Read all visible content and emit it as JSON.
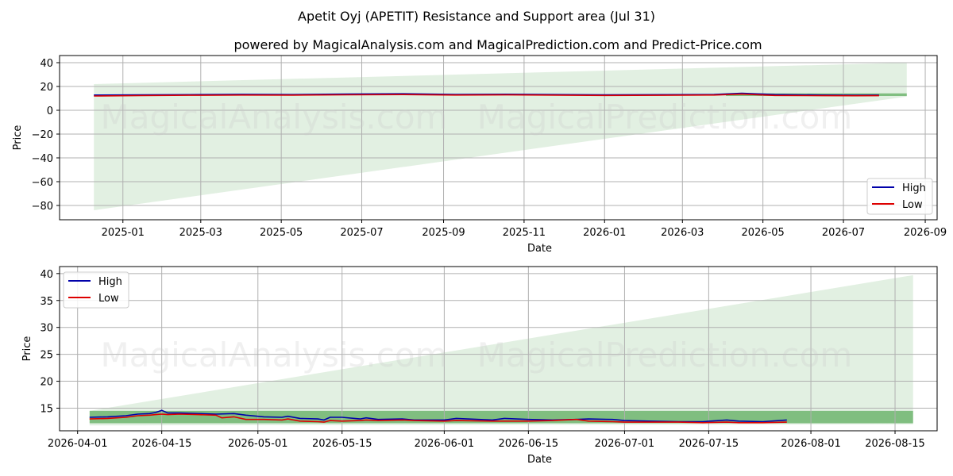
{
  "title": "Apetit Oyj (APETIT) Resistance and Support area (Jul 31)",
  "subtitle": "powered by MagicalAnalysis.com and MagicalPrediction.com and Predict-Price.com",
  "watermarks": [
    "MagicalAnalysis.com",
    "MagicalPrediction.com"
  ],
  "colors": {
    "high": "#0000aa",
    "low": "#dd0000",
    "band_light": "#d6ead6",
    "band_dark": "#5fae5f",
    "grid": "#b0b0b0"
  },
  "chart_data": [
    {
      "type": "line",
      "xlabel": "Date",
      "ylabel": "Price",
      "ylim": [
        -92,
        46
      ],
      "yticks": [
        40,
        20,
        0,
        -20,
        -40,
        -60,
        -80
      ],
      "xticks": [
        "2025-01",
        "2025-03",
        "2025-05",
        "2025-07",
        "2025-09",
        "2025-11",
        "2026-01",
        "2026-03",
        "2026-05",
        "2026-07",
        "2026-09"
      ],
      "xlim": [
        "2024-11-14",
        "2026-09-10"
      ],
      "grid": true,
      "legend": "lower-right",
      "series": [
        {
          "name": "High",
          "x": [
            "2024-12-10",
            "2025-01-15",
            "2025-02-20",
            "2025-04-01",
            "2025-05-10",
            "2025-06-20",
            "2025-08-01",
            "2025-09-10",
            "2025-10-20",
            "2025-11-25",
            "2026-01-01",
            "2026-02-15",
            "2026-03-25",
            "2026-04-15",
            "2026-05-10",
            "2026-06-15",
            "2026-07-10",
            "2026-07-28"
          ],
          "values": [
            12.8,
            13.0,
            13.1,
            13.4,
            13.2,
            13.6,
            13.9,
            13.3,
            13.5,
            13.2,
            13.0,
            13.1,
            13.3,
            14.3,
            13.2,
            12.8,
            12.6,
            12.7
          ]
        },
        {
          "name": "Low",
          "x": [
            "2024-12-10",
            "2025-01-15",
            "2025-02-20",
            "2025-04-01",
            "2025-05-10",
            "2025-06-20",
            "2025-08-01",
            "2025-09-10",
            "2025-10-20",
            "2025-11-25",
            "2026-01-01",
            "2026-02-15",
            "2026-03-25",
            "2026-04-15",
            "2026-05-10",
            "2026-06-15",
            "2026-07-10",
            "2026-07-28"
          ],
          "values": [
            12.0,
            12.4,
            12.6,
            12.8,
            12.7,
            13.0,
            13.2,
            12.8,
            12.9,
            12.7,
            12.5,
            12.6,
            12.8,
            13.6,
            12.5,
            12.3,
            12.2,
            12.3
          ]
        }
      ],
      "support_area": {
        "x": [
          "2024-12-10",
          "2026-08-18"
        ],
        "upper": [
          22,
          40
        ],
        "lower": [
          -84,
          11.5
        ]
      },
      "resistance_band": {
        "x": [
          "2026-04-03",
          "2026-08-18"
        ],
        "upper": 14.2,
        "lower": 12.0
      }
    },
    {
      "type": "line",
      "xlabel": "Date",
      "ylabel": "Price",
      "ylim": [
        10.8,
        41.3
      ],
      "yticks": [
        15,
        20,
        25,
        30,
        35,
        40
      ],
      "xticks": [
        "2026-04-01",
        "2026-04-15",
        "2026-05-01",
        "2026-05-15",
        "2026-06-01",
        "2026-06-15",
        "2026-07-01",
        "2026-07-15",
        "2026-08-01",
        "2026-08-15"
      ],
      "xlim": [
        "2026-03-29",
        "2026-08-22"
      ],
      "grid": true,
      "legend": "upper-left",
      "series": [
        {
          "name": "High",
          "x": [
            "2026-04-03",
            "2026-04-06",
            "2026-04-09",
            "2026-04-11",
            "2026-04-13",
            "2026-04-14",
            "2026-04-15",
            "2026-04-16",
            "2026-04-18",
            "2026-04-21",
            "2026-04-24",
            "2026-04-27",
            "2026-04-29",
            "2026-05-02",
            "2026-05-05",
            "2026-05-06",
            "2026-05-08",
            "2026-05-11",
            "2026-05-12",
            "2026-05-13",
            "2026-05-15",
            "2026-05-18",
            "2026-05-19",
            "2026-05-21",
            "2026-05-25",
            "2026-05-27",
            "2026-06-01",
            "2026-06-03",
            "2026-06-09",
            "2026-06-11",
            "2026-06-15",
            "2026-06-19",
            "2026-06-23",
            "2026-06-25",
            "2026-06-29",
            "2026-07-01",
            "2026-07-05",
            "2026-07-10",
            "2026-07-14",
            "2026-07-18",
            "2026-07-20",
            "2026-07-24",
            "2026-07-28"
          ],
          "values": [
            13.3,
            13.4,
            13.6,
            13.9,
            14.0,
            14.2,
            14.6,
            14.1,
            14.1,
            14.0,
            13.9,
            14.0,
            13.7,
            13.4,
            13.3,
            13.5,
            13.1,
            13.0,
            12.8,
            13.3,
            13.3,
            13.0,
            13.2,
            12.9,
            13.0,
            12.8,
            12.8,
            13.1,
            12.8,
            13.1,
            12.9,
            12.8,
            12.9,
            13.0,
            12.9,
            12.7,
            12.6,
            12.5,
            12.5,
            12.8,
            12.6,
            12.5,
            12.8
          ]
        },
        {
          "name": "Low",
          "x": [
            "2026-04-03",
            "2026-04-06",
            "2026-04-09",
            "2026-04-11",
            "2026-04-13",
            "2026-04-14",
            "2026-04-15",
            "2026-04-16",
            "2026-04-18",
            "2026-04-21",
            "2026-04-24",
            "2026-04-25",
            "2026-04-27",
            "2026-04-29",
            "2026-05-02",
            "2026-05-05",
            "2026-05-06",
            "2026-05-08",
            "2026-05-11",
            "2026-05-12",
            "2026-05-13",
            "2026-05-15",
            "2026-05-18",
            "2026-05-19",
            "2026-05-21",
            "2026-05-25",
            "2026-05-27",
            "2026-06-01",
            "2026-06-03",
            "2026-06-09",
            "2026-06-11",
            "2026-06-15",
            "2026-06-19",
            "2026-06-23",
            "2026-06-25",
            "2026-06-29",
            "2026-07-01",
            "2026-07-05",
            "2026-07-10",
            "2026-07-14",
            "2026-07-18",
            "2026-07-20",
            "2026-07-24",
            "2026-07-28"
          ],
          "values": [
            13.0,
            13.1,
            13.3,
            13.6,
            13.7,
            13.8,
            13.9,
            13.8,
            13.9,
            13.8,
            13.7,
            13.2,
            13.4,
            12.9,
            12.9,
            12.8,
            13.0,
            12.6,
            12.5,
            12.4,
            12.7,
            12.6,
            12.7,
            12.8,
            12.7,
            12.8,
            12.7,
            12.6,
            12.7,
            12.6,
            12.6,
            12.6,
            12.7,
            12.9,
            12.6,
            12.5,
            12.4,
            12.4,
            12.4,
            12.3,
            12.4,
            12.3,
            12.3,
            12.4
          ]
        }
      ],
      "support_area": {
        "x": [
          "2026-04-03",
          "2026-08-18"
        ],
        "upper": [
          14.5,
          39.7
        ],
        "lower": [
          11.8,
          12.0
        ]
      },
      "resistance_band": {
        "x": [
          "2026-04-03",
          "2026-08-18"
        ],
        "upper": 14.5,
        "lower": 12.2
      }
    }
  ]
}
